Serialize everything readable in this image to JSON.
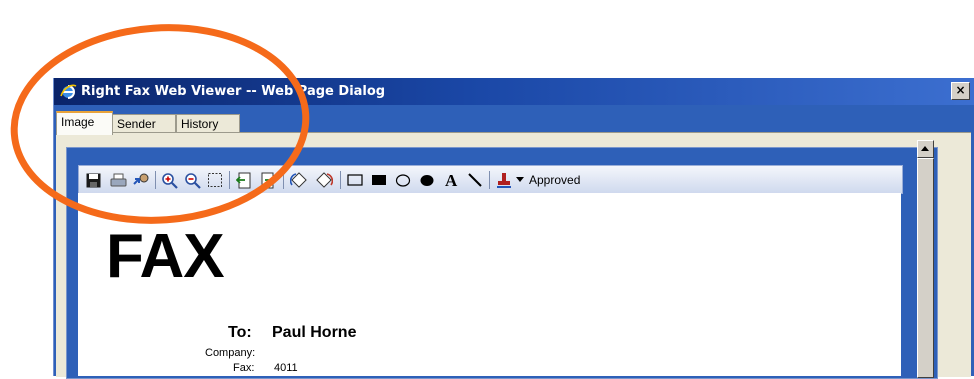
{
  "window": {
    "title": "Right Fax Web Viewer -- Web Page Dialog",
    "close_label": "×"
  },
  "tabs": [
    {
      "label": "Image",
      "active": true
    },
    {
      "label": "Sender",
      "active": false
    },
    {
      "label": "History",
      "active": false
    }
  ],
  "toolbar": {
    "stamp_label": "Approved",
    "icons": [
      "save-icon",
      "print-icon",
      "annotate-icon",
      "zoom-in-icon",
      "zoom-out-icon",
      "fit-page-icon",
      "prev-page-icon",
      "next-page-icon",
      "rotate-left-icon",
      "rotate-right-icon",
      "rectangle-icon",
      "filled-rectangle-icon",
      "ellipse-icon",
      "filled-ellipse-icon",
      "text-icon",
      "line-icon",
      "stamp-icon",
      "dropdown-arrow-icon"
    ]
  },
  "document": {
    "heading": "FAX",
    "to_label": "To:",
    "to_value": "Paul Horne",
    "company_label": "Company:",
    "fax_label": "Fax:",
    "fax_value": "4011"
  },
  "colors": {
    "window_blue": "#2e60b8",
    "annotation": "#f56a1a"
  }
}
